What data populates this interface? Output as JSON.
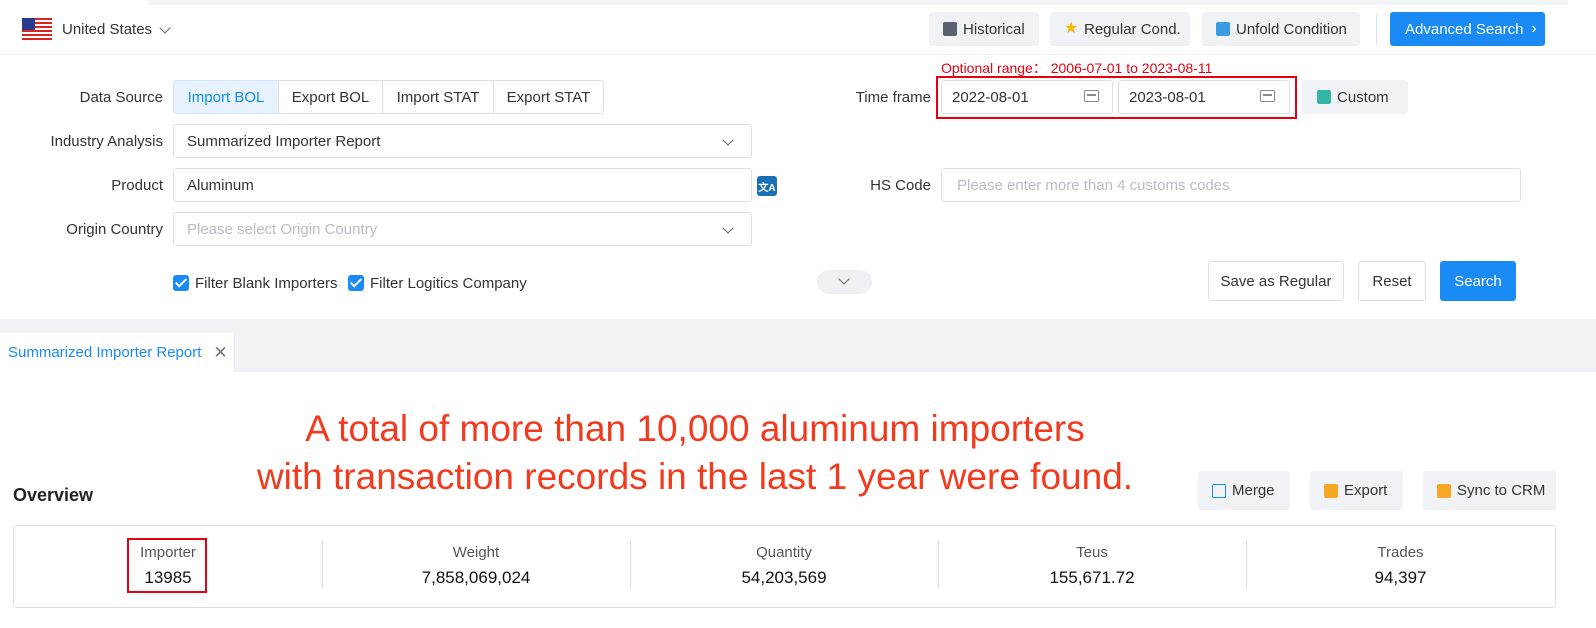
{
  "header": {
    "country": "United States",
    "buttons": {
      "historical": "Historical",
      "regular_cond": "Regular Cond.",
      "unfold_condition": "Unfold Condition",
      "advanced_search": "Advanced Search"
    }
  },
  "form": {
    "data_source": {
      "label": "Data Source",
      "options": [
        "Import BOL",
        "Export BOL",
        "Import STAT",
        "Export STAT"
      ],
      "selected": "Import BOL"
    },
    "industry_analysis": {
      "label": "Industry Analysis",
      "value": "Summarized Importer Report"
    },
    "product": {
      "label": "Product",
      "value": "Aluminum"
    },
    "origin_country": {
      "label": "Origin Country",
      "placeholder": "Please select Origin Country"
    },
    "time_frame": {
      "label": "Time frame",
      "optional_range": "Optional range： 2006-07-01 to 2023-08-11",
      "start": "2022-08-01",
      "end": "2023-08-01",
      "custom": "Custom"
    },
    "hs_code": {
      "label": "HS Code",
      "placeholder": "Please enter more than 4 customs codes"
    },
    "filters": {
      "blank_importers": "Filter Blank Importers",
      "logistics_company": "Filter Logitics Company"
    },
    "actions": {
      "save_regular": "Save as Regular",
      "reset": "Reset",
      "search": "Search"
    }
  },
  "tabs": {
    "report": "Summarized Importer Report"
  },
  "annotation": {
    "line1": "A total of more than 10,000 aluminum importers",
    "line2": "with transaction records in the last 1 year were found."
  },
  "overview": {
    "title": "Overview",
    "buttons": {
      "merge": "Merge",
      "export": "Export",
      "sync": "Sync to CRM"
    },
    "stats": {
      "importer": {
        "label": "Importer",
        "value": "13985"
      },
      "weight": {
        "label": "Weight",
        "value": "7,858,069,024"
      },
      "quantity": {
        "label": "Quantity",
        "value": "54,203,569"
      },
      "teus": {
        "label": "Teus",
        "value": "155,671.72"
      },
      "trades": {
        "label": "Trades",
        "value": "94,397"
      }
    }
  },
  "colors": {
    "accent": "#1a8bf5",
    "highlight": "#e60012",
    "annotation": "#f23a1f"
  },
  "icons": [
    "us-flag-icon",
    "chevron-down-icon",
    "history-icon",
    "star-icon",
    "unfold-icon",
    "chevron-right-icon",
    "calendar-icon",
    "translate-icon",
    "checkbox-icon",
    "close-icon",
    "merge-icon",
    "export-icon",
    "sync-icon",
    "custom-icon"
  ]
}
